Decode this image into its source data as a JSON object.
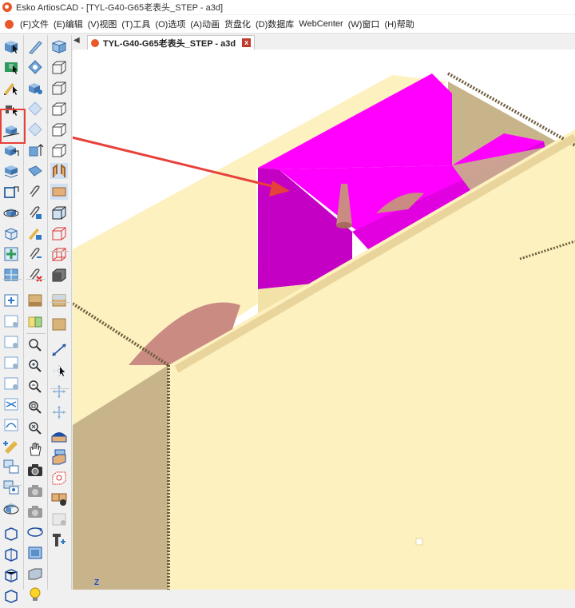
{
  "window": {
    "title": "Esko ArtiosCAD - [TYL-G40-G65老表头_STEP - a3d]"
  },
  "menu": [
    "(F)文件",
    "(E)编辑",
    "(V)视图",
    "(T)工具",
    "(O)选项",
    "(A)动画",
    "货盘化",
    "(D)数据库",
    "WebCenter",
    "(W)窗口",
    "(H)帮助"
  ],
  "tab": {
    "label": "TYL-G40-G65老表头_STEP - a3d",
    "close": "x"
  },
  "axis_label": "Z",
  "colors": {
    "box_face": "#fdf1c0",
    "box_shadow": "#e9d59c",
    "inner_wall": "#c8b48a",
    "magenta": "#ff00ff",
    "magenta_dark": "#c400c4",
    "pink_part": "#c98b82",
    "annotation_red": "#e8403a"
  }
}
